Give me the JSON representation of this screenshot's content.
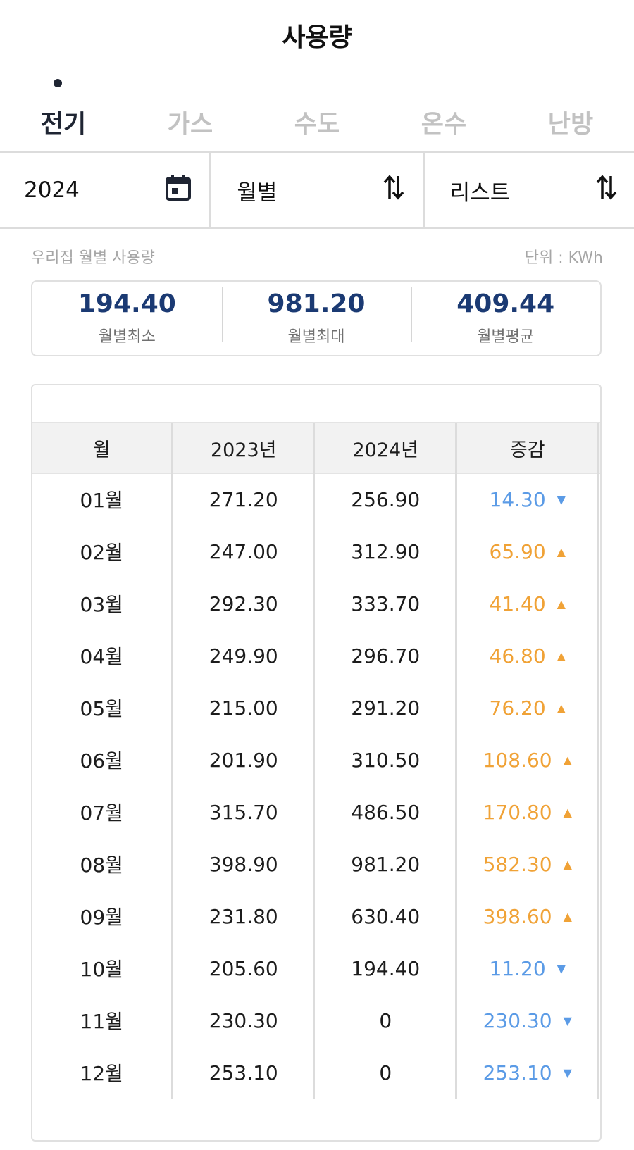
{
  "header": {
    "title": "사용량"
  },
  "tabs": [
    {
      "label": "전기",
      "active": true
    },
    {
      "label": "가스",
      "active": false
    },
    {
      "label": "수도",
      "active": false
    },
    {
      "label": "온수",
      "active": false
    },
    {
      "label": "난방",
      "active": false
    }
  ],
  "filters": {
    "year": "2024",
    "period": "월별",
    "view": "리스트"
  },
  "caption": {
    "left": "우리집 월별 사용량",
    "right": "단위 : KWh"
  },
  "summary": [
    {
      "value": "194.40",
      "label": "월별최소"
    },
    {
      "value": "981.20",
      "label": "월별최대"
    },
    {
      "value": "409.44",
      "label": "월별평균"
    }
  ],
  "table": {
    "headers": [
      "월",
      "2023년",
      "2024년",
      "증감"
    ],
    "rows": [
      {
        "month": "01월",
        "y2023": "271.20",
        "y2024": "256.90",
        "diff": "14.30",
        "trend": "down"
      },
      {
        "month": "02월",
        "y2023": "247.00",
        "y2024": "312.90",
        "diff": "65.90",
        "trend": "up"
      },
      {
        "month": "03월",
        "y2023": "292.30",
        "y2024": "333.70",
        "diff": "41.40",
        "trend": "up"
      },
      {
        "month": "04월",
        "y2023": "249.90",
        "y2024": "296.70",
        "diff": "46.80",
        "trend": "up"
      },
      {
        "month": "05월",
        "y2023": "215.00",
        "y2024": "291.20",
        "diff": "76.20",
        "trend": "up"
      },
      {
        "month": "06월",
        "y2023": "201.90",
        "y2024": "310.50",
        "diff": "108.60",
        "trend": "up"
      },
      {
        "month": "07월",
        "y2023": "315.70",
        "y2024": "486.50",
        "diff": "170.80",
        "trend": "up"
      },
      {
        "month": "08월",
        "y2023": "398.90",
        "y2024": "981.20",
        "diff": "582.30",
        "trend": "up"
      },
      {
        "month": "09월",
        "y2023": "231.80",
        "y2024": "630.40",
        "diff": "398.60",
        "trend": "up"
      },
      {
        "month": "10월",
        "y2023": "205.60",
        "y2024": "194.40",
        "diff": "11.20",
        "trend": "down"
      },
      {
        "month": "11월",
        "y2023": "230.30",
        "y2024": "0",
        "diff": "230.30",
        "trend": "down"
      },
      {
        "month": "12월",
        "y2023": "253.10",
        "y2024": "0",
        "diff": "253.10",
        "trend": "down"
      }
    ]
  },
  "colors": {
    "up": "#f0a236",
    "down": "#5b9be6",
    "summary_value": "#1b3a73"
  },
  "icons": {
    "year": "calendar-icon",
    "period": "sort-arrows-icon",
    "view": "sort-arrows-icon"
  }
}
